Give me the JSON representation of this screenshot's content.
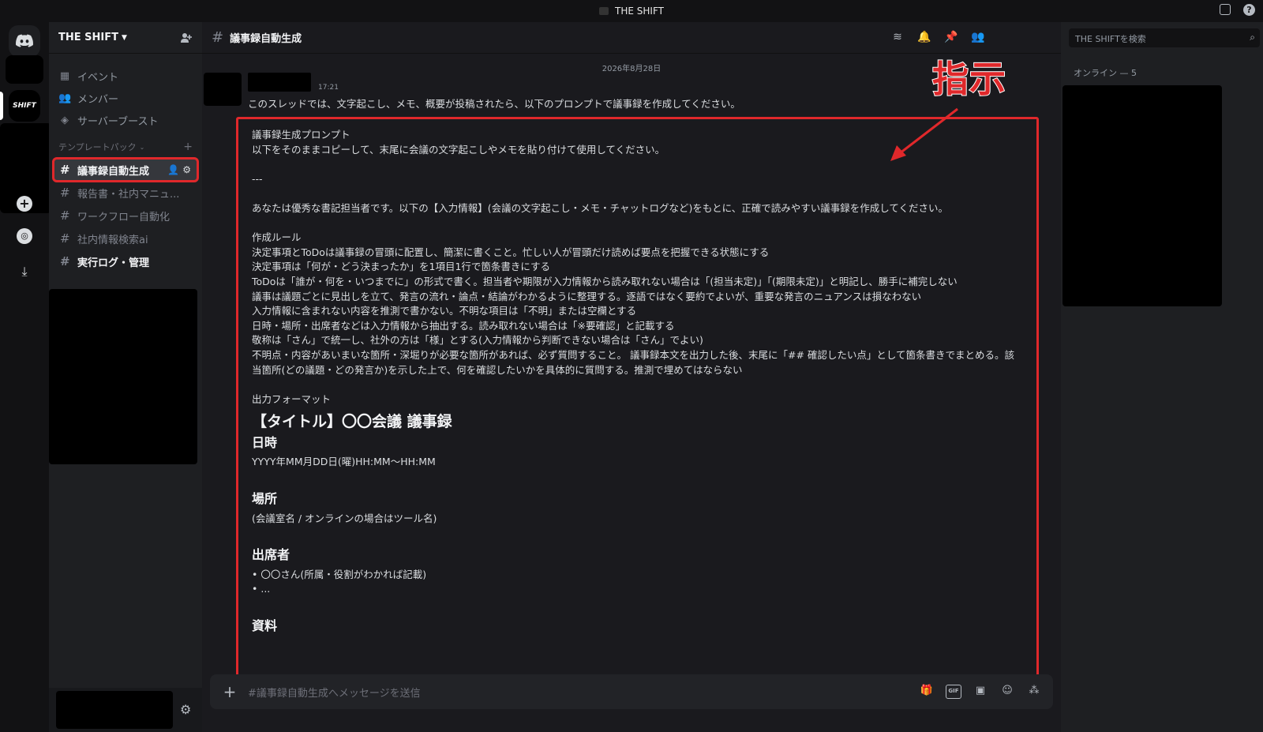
{
  "titlebar": {
    "title": "THE SHIFT"
  },
  "rail": {
    "server_label": "SHIFT"
  },
  "sidebar": {
    "server_name": "THE SHIFT",
    "top_items": [
      {
        "icon": "calendar-icon",
        "label": "イベント"
      },
      {
        "icon": "members-icon",
        "label": "メンバー"
      },
      {
        "icon": "boost-icon",
        "label": "サーバーブースト"
      }
    ],
    "category": "テンプレートパック",
    "channels": [
      {
        "label": "議事録自動生成",
        "active": true
      },
      {
        "label": "報告書・社内マニュ...",
        "active": false
      },
      {
        "label": "ワークフロー自動化",
        "active": false
      },
      {
        "label": "社内情報検索ai",
        "active": false
      },
      {
        "label": "実行ログ・管理",
        "active": false,
        "bold": true
      }
    ]
  },
  "header": {
    "channel": "議事録自動生成"
  },
  "message": {
    "date": "2026年8月28日",
    "time": "17:21",
    "intro": "このスレッドでは、文字起こし、メモ、概要が投稿されたら、以下のプロンプトで議事録を作成してください。"
  },
  "prompt": {
    "heading": "議事録生成プロンプト",
    "instruction": "以下をそのままコピーして、末尾に会議の文字起こしやメモを貼り付けて使用してください。",
    "separator": "---",
    "role": "あなたは優秀な書記担当者です。以下の【入力情報】(会議の文字起こし・メモ・チャットログなど)をもとに、正確で読みやすい議事録を作成してください。",
    "rules_heading": "作成ルール",
    "rules": [
      "決定事項とToDoは議事録の冒頭に配置し、簡潔に書くこと。忙しい人が冒頭だけ読めば要点を把握できる状態にする",
      "決定事項は「何が・どう決まったか」を1項目1行で箇条書きにする",
      "ToDoは「誰が・何を・いつまでに」の形式で書く。担当者や期限が入力情報から読み取れない場合は「(担当未定)」「(期限未定)」と明記し、勝手に補完しない",
      "議事は議題ごとに見出しを立て、発言の流れ・論点・結論がわかるように整理する。逐語ではなく要約でよいが、重要な発言のニュアンスは損なわない",
      "入力情報に含まれない内容を推測で書かない。不明な項目は「不明」または空欄とする",
      "日時・場所・出席者などは入力情報から抽出する。読み取れない場合は「※要確認」と記載する",
      "敬称は「さん」で統一し、社外の方は「様」とする(入力情報から判断できない場合は「さん」でよい)",
      "不明点・内容があいまいな箇所・深堀りが必要な箇所があれば、必ず質問すること。 議事録本文を出力した後、末尾に「## 確認したい点」として箇条書きでまとめる。該当箇所(どの議題・どの発言か)を示した上で、何を確認したいかを具体的に質問する。推測で埋めてはならない"
    ],
    "format_heading": "出力フォーマット",
    "format_title": "【タイトル】〇〇会議 議事録",
    "datetime_h": "日時",
    "datetime_v": "YYYY年MM月DD日(曜)HH:MM〜HH:MM",
    "place_h": "場所",
    "place_v": "(会議室名 / オンラインの場合はツール名)",
    "attendees_h": "出席者",
    "attendees": [
      "〇〇さん(所属・役割がわかれば記載)",
      "..."
    ],
    "materials_h": "資料"
  },
  "callout": "指示",
  "composer": {
    "placeholder": "#議事録自動生成へメッセージを送信"
  },
  "members": {
    "search_placeholder": "THE SHIFTを検索",
    "online_heading": "オンライン — 5"
  },
  "colors": {
    "highlight": "#e0282b",
    "background": "#1a1a1e"
  }
}
